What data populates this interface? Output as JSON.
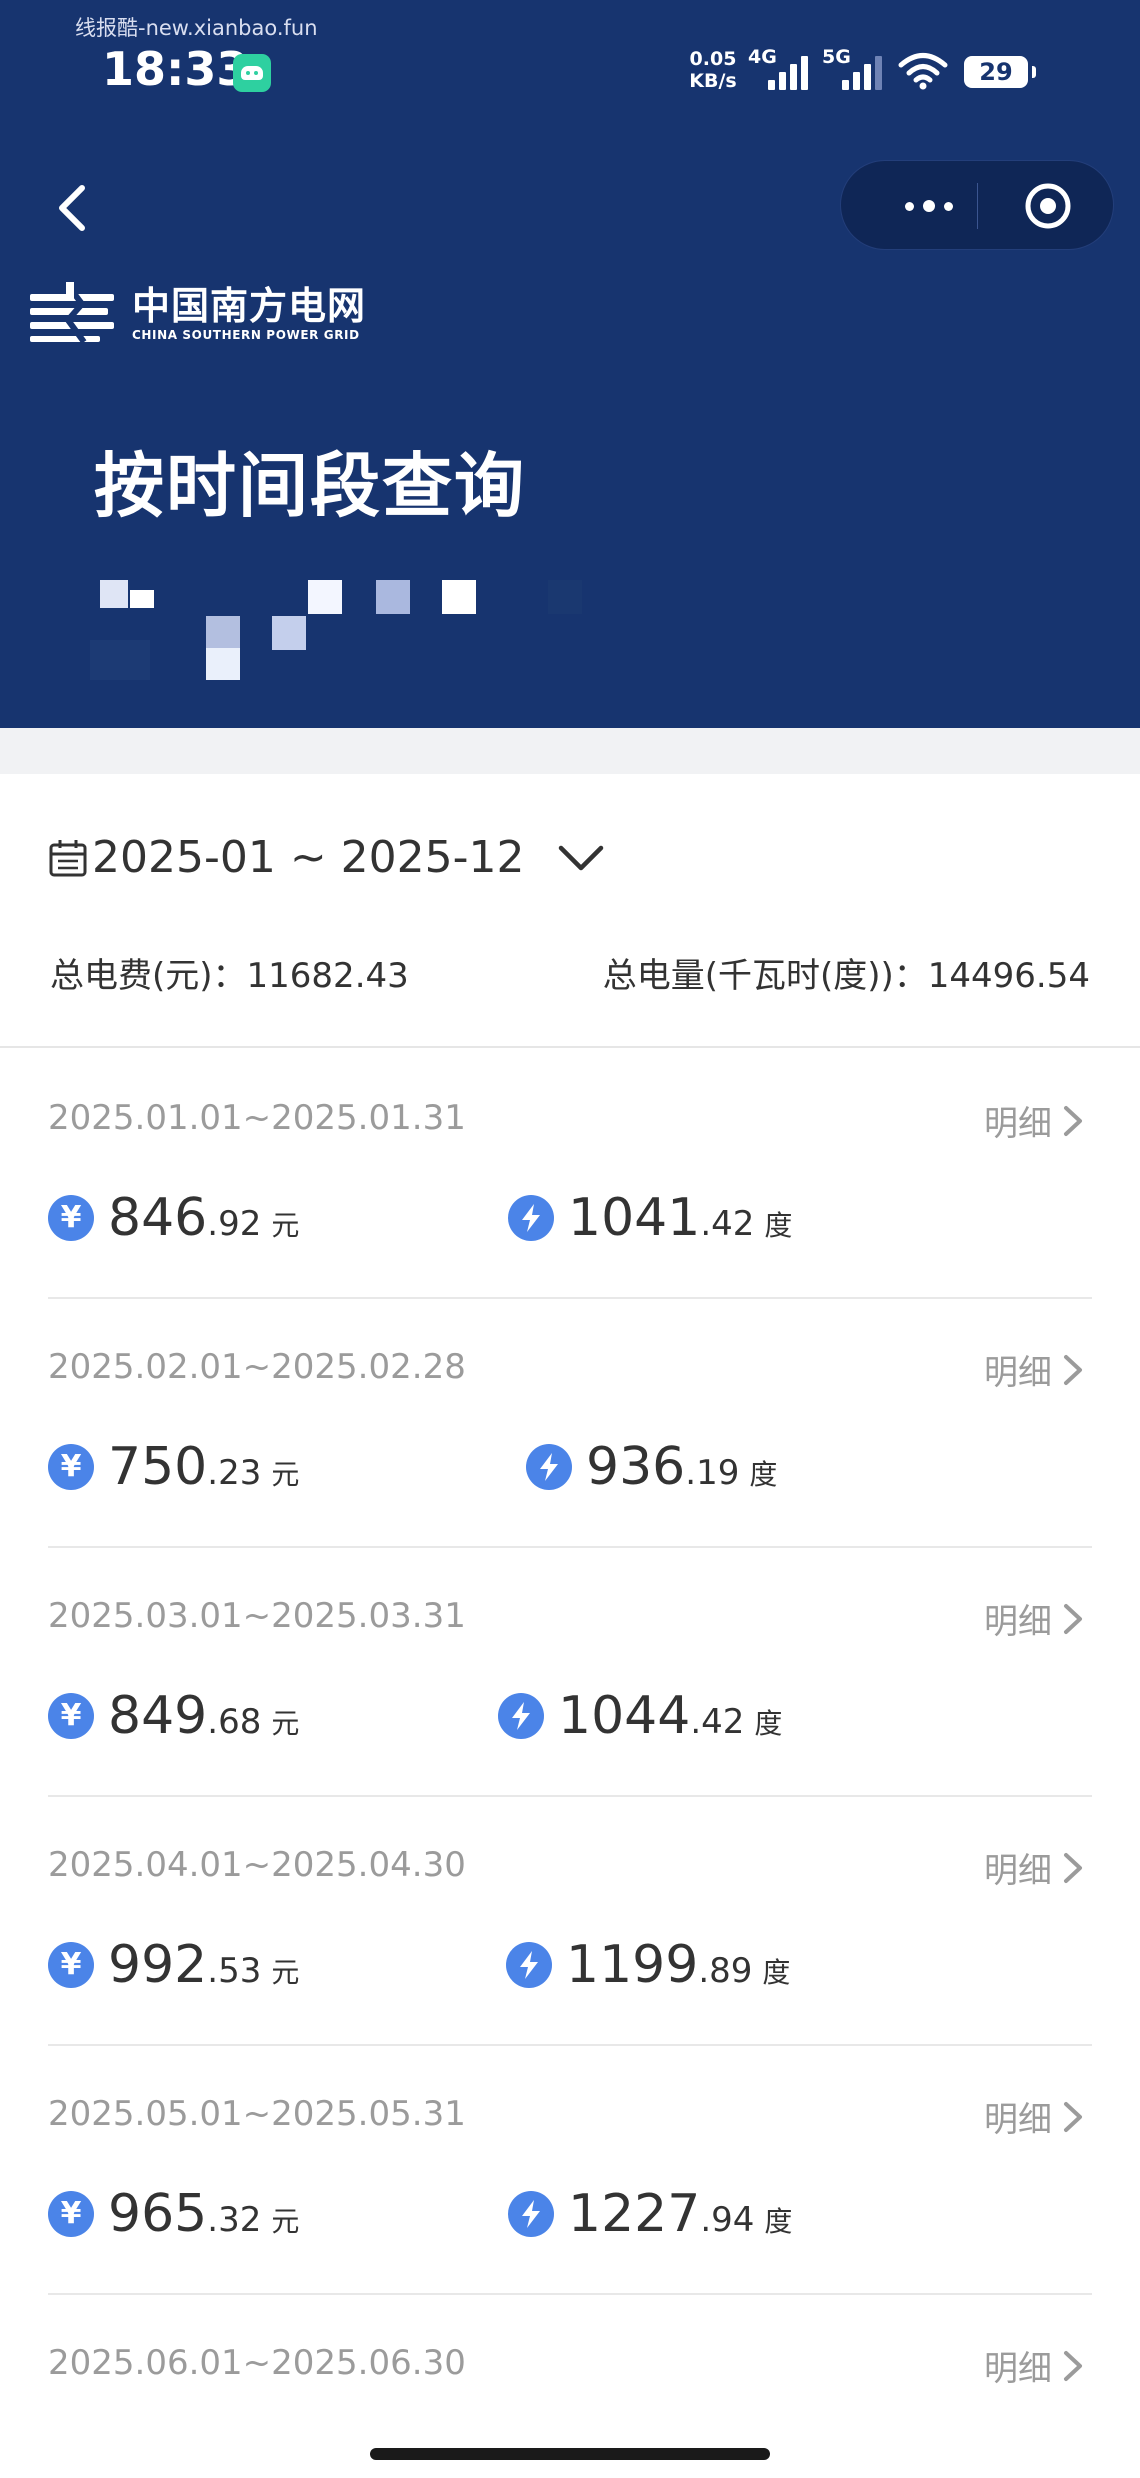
{
  "status_bar": {
    "watermark": "线报酷-new.xianbao.fun",
    "time": "18:33",
    "net_speed_value": "0.05",
    "net_speed_unit": "KB/s",
    "signal_1": "4G",
    "signal_2": "5G",
    "battery": "29",
    "icons": [
      "app-notification-icon",
      "signal-4g-icon",
      "signal-5g-icon",
      "wifi-icon",
      "battery-icon"
    ]
  },
  "nav": {
    "back_icon": "chevron-left-icon",
    "more_icon": "more-dots-icon",
    "close_icon": "target-circle-icon"
  },
  "brand": {
    "name_cn": "中国南方电网",
    "name_en": "CHINA SOUTHERN POWER GRID"
  },
  "page": {
    "title": "按时间段查询"
  },
  "filter": {
    "date_range": "2025-01 ~ 2025-12",
    "calendar_icon": "calendar-icon",
    "dropdown_icon": "chevron-down-icon",
    "total_fee_label": "总电费(元)：",
    "total_fee_value": "11682.43",
    "total_kwh_label": "总电量(千瓦时(度))：",
    "total_kwh_value": "14496.54"
  },
  "colors": {
    "header_bg": "#17346f",
    "accent_blue": "#4b84e8",
    "muted_text": "#9b9b9b"
  },
  "bills": [
    {
      "period": "2025.01.01~2025.01.31",
      "detail": "明细",
      "fee_int": "846",
      "fee_dec": ".92",
      "fee_unit": "元",
      "kwh_int": "1041",
      "kwh_dec": ".42",
      "kwh_unit": "度"
    },
    {
      "period": "2025.02.01~2025.02.28",
      "detail": "明细",
      "fee_int": "750",
      "fee_dec": ".23",
      "fee_unit": "元",
      "kwh_int": "936",
      "kwh_dec": ".19",
      "kwh_unit": "度"
    },
    {
      "period": "2025.03.01~2025.03.31",
      "detail": "明细",
      "fee_int": "849",
      "fee_dec": ".68",
      "fee_unit": "元",
      "kwh_int": "1044",
      "kwh_dec": ".42",
      "kwh_unit": "度"
    },
    {
      "period": "2025.04.01~2025.04.30",
      "detail": "明细",
      "fee_int": "992",
      "fee_dec": ".53",
      "fee_unit": "元",
      "kwh_int": "1199",
      "kwh_dec": ".89",
      "kwh_unit": "度"
    },
    {
      "period": "2025.05.01~2025.05.31",
      "detail": "明细",
      "fee_int": "965",
      "fee_dec": ".32",
      "fee_unit": "元",
      "kwh_int": "1227",
      "kwh_dec": ".94",
      "kwh_unit": "度"
    },
    {
      "period": "2025.06.01~2025.06.30",
      "detail": "明细"
    }
  ]
}
